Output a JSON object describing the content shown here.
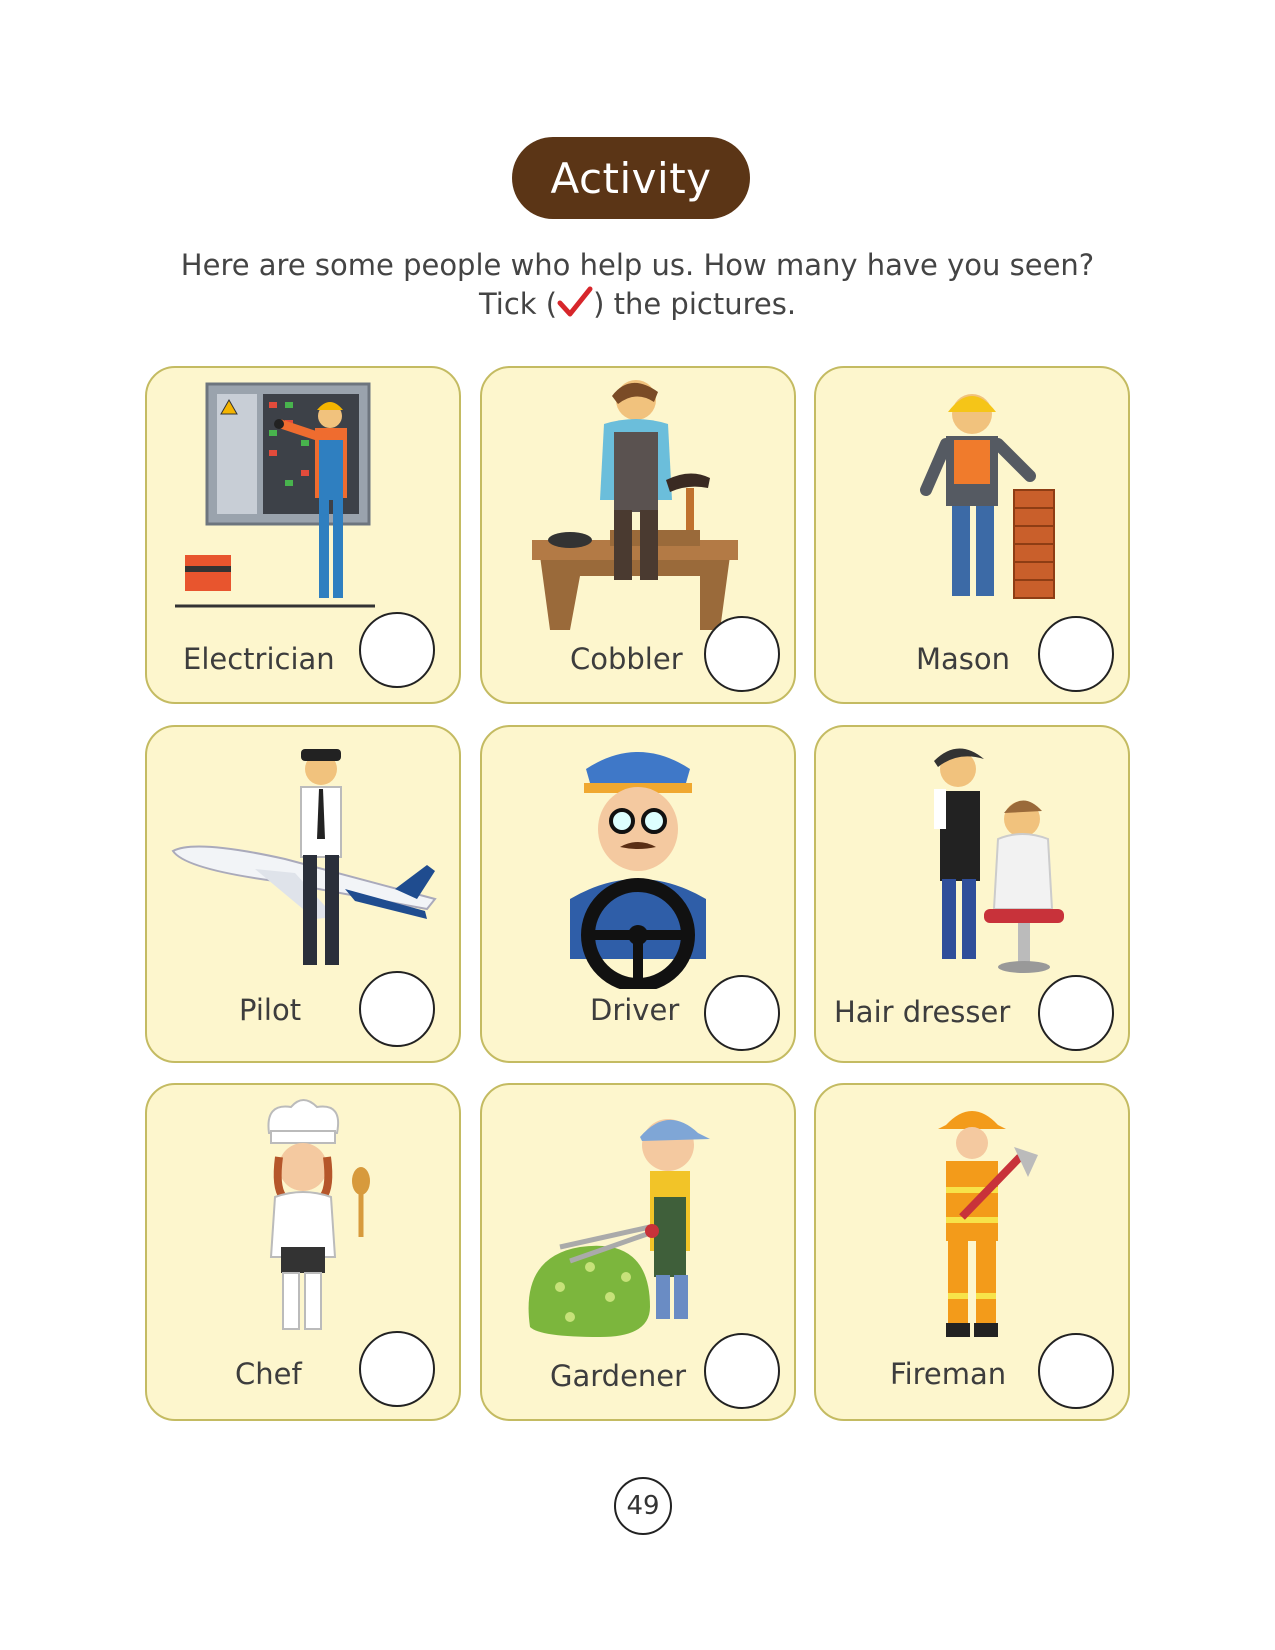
{
  "title": "Activity",
  "instructions": {
    "line1": "Here are some people who help us. How many have you seen?",
    "line2_before": "Tick (",
    "line2_after": ") the pictures."
  },
  "cards": [
    {
      "label": "Electrician",
      "icon": "electrician-illustration",
      "checked": false
    },
    {
      "label": "Cobbler",
      "icon": "cobbler-illustration",
      "checked": false
    },
    {
      "label": "Mason",
      "icon": "mason-illustration",
      "checked": false
    },
    {
      "label": "Pilot",
      "icon": "pilot-illustration",
      "checked": false
    },
    {
      "label": "Driver",
      "icon": "driver-illustration",
      "checked": false
    },
    {
      "label": "Hair dresser",
      "icon": "hair-dresser-illustration",
      "checked": false
    },
    {
      "label": "Chef",
      "icon": "chef-illustration",
      "checked": false
    },
    {
      "label": "Gardener",
      "icon": "gardener-illustration",
      "checked": false
    },
    {
      "label": "Fireman",
      "icon": "fireman-illustration",
      "checked": false
    }
  ],
  "page_number": "49",
  "colors": {
    "title_bg": "#5b3516",
    "card_bg": "#fdf6cd",
    "card_border": "#c4bb62",
    "tick": "#d7262b"
  }
}
